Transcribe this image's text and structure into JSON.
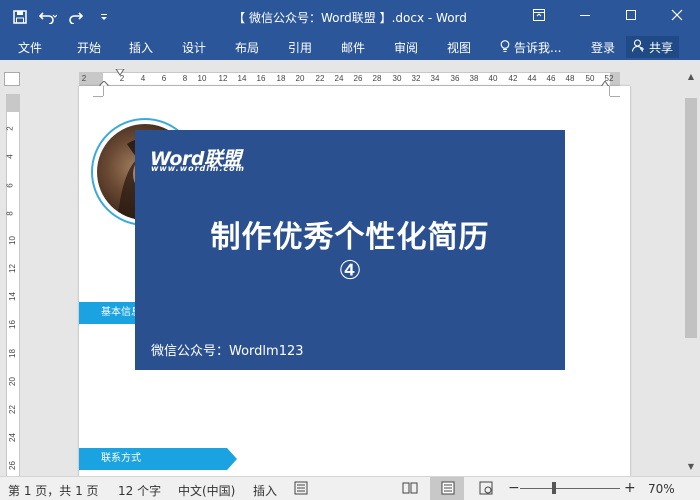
{
  "window": {
    "title": "【 微信公众号：Word联盟 】.docx - Word"
  },
  "colors": {
    "ribbon": "#2b579a",
    "card": "#2b5090",
    "accent": "#1aa3e0"
  },
  "qat": {
    "save_icon": "save-icon",
    "undo_icon": "undo-icon",
    "redo_icon": "redo-icon",
    "customize_icon": "customize-qat-icon"
  },
  "ribbon": {
    "tabs": [
      "文件",
      "开始",
      "插入",
      "设计",
      "布局",
      "引用",
      "邮件",
      "审阅",
      "视图"
    ],
    "tell_me": "告诉我...",
    "login": "登录",
    "share": "共享"
  },
  "hruler": {
    "ticks": [
      "2",
      "2",
      "4",
      "6",
      "8",
      "10",
      "12",
      "14",
      "16",
      "18",
      "20",
      "22",
      "24",
      "26",
      "28",
      "30",
      "32",
      "34",
      "36",
      "38",
      "40",
      "42",
      "44",
      "46",
      "48",
      "50",
      "52"
    ]
  },
  "vruler": {
    "ticks": [
      "2",
      "4",
      "6",
      "8",
      "10",
      "12",
      "14",
      "16",
      "18",
      "20",
      "22",
      "24",
      "26"
    ]
  },
  "document": {
    "section1": "基本信息",
    "section2": "联系方式"
  },
  "card": {
    "brand": "Word联盟",
    "brand_url": "www.wordlm.com",
    "title": "制作优秀个性化简历",
    "number": "④",
    "footer": "微信公众号：Wordlm123"
  },
  "status": {
    "page": "第 1 页，共 1 页",
    "words": "12 个字",
    "language": "中文(中国)",
    "mode": "插入",
    "zoom": "70%",
    "zoom_level": 0.7
  }
}
